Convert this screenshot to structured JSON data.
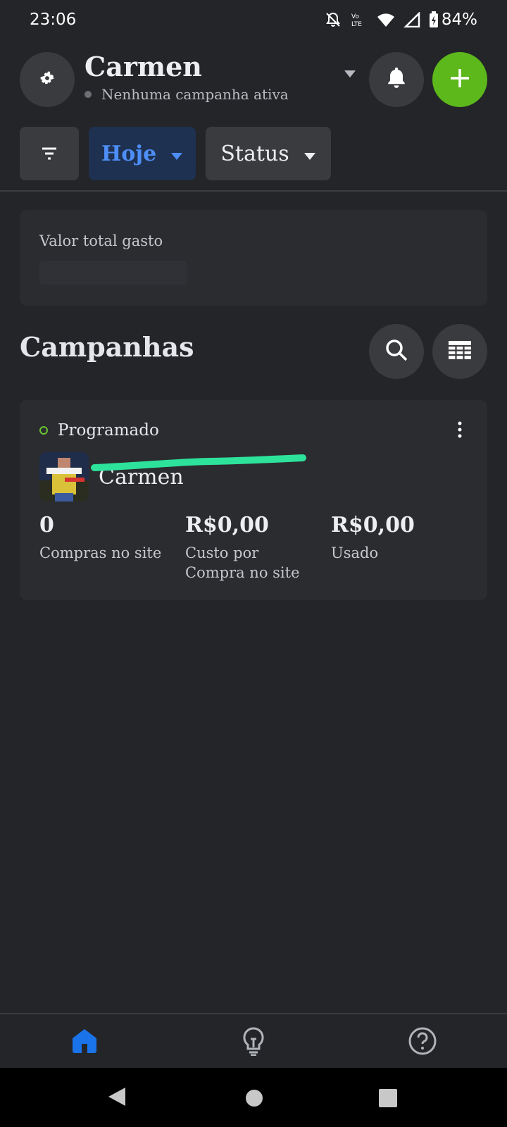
{
  "status_bar": {
    "time": "23:06",
    "battery": "84%",
    "icons": [
      "bell-off-icon",
      "volte-icon",
      "wifi-icon",
      "signal-icon",
      "battery-charging-icon"
    ]
  },
  "header": {
    "account_name": "Carmen",
    "subtitle": "Nenhuma campanha ativa",
    "settings_icon": "gear-icon",
    "notifications_icon": "bell-icon",
    "create_icon": "plus-icon",
    "create_color": "#5db81b"
  },
  "filters": {
    "filter_icon": "filter-icon",
    "date_label": "Hoje",
    "status_label": "Status"
  },
  "summary": {
    "label": "Valor total gasto"
  },
  "campaigns": {
    "title": "Campanhas",
    "items": [
      {
        "status": "Programado",
        "name": "Carmen",
        "metrics": [
          {
            "value": "0",
            "label": "Compras no site"
          },
          {
            "value": "R$0,00",
            "label": "Custo por Compra no site"
          },
          {
            "value": "R$0,00",
            "label": "Usado"
          }
        ]
      }
    ]
  },
  "bottom_nav": {
    "items": [
      "home-icon",
      "lightbulb-icon",
      "help-icon"
    ],
    "active_color": "#1a73e8"
  }
}
